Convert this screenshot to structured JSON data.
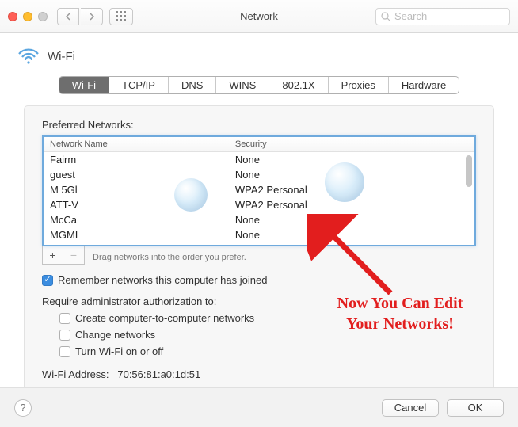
{
  "window": {
    "title": "Network",
    "search_placeholder": "Search"
  },
  "header": {
    "title": "Wi-Fi"
  },
  "tabs": [
    {
      "label": "Wi-Fi",
      "active": true
    },
    {
      "label": "TCP/IP",
      "active": false
    },
    {
      "label": "DNS",
      "active": false
    },
    {
      "label": "WINS",
      "active": false
    },
    {
      "label": "802.1X",
      "active": false
    },
    {
      "label": "Proxies",
      "active": false
    },
    {
      "label": "Hardware",
      "active": false
    }
  ],
  "networks": {
    "section_label": "Preferred Networks:",
    "columns": {
      "name": "Network Name",
      "security": "Security"
    },
    "rows": [
      {
        "name": "Fairm",
        "security": "None"
      },
      {
        "name": "guest",
        "security": "None"
      },
      {
        "name": "M 5Gl",
        "security": "WPA2 Personal"
      },
      {
        "name": "ATT-V",
        "security": "WPA2 Personal"
      },
      {
        "name": "McCa",
        "security": "None"
      },
      {
        "name": "MGMI",
        "security": "None"
      }
    ],
    "hint": "Drag networks into the order you prefer."
  },
  "options": {
    "remember_label": "Remember networks this computer has joined",
    "remember_checked": true,
    "admin_heading": "Require administrator authorization to:",
    "admin_items": [
      {
        "label": "Create computer-to-computer networks",
        "checked": false
      },
      {
        "label": "Change networks",
        "checked": false
      },
      {
        "label": "Turn Wi-Fi on or off",
        "checked": false
      }
    ]
  },
  "address": {
    "label": "Wi-Fi Address:",
    "value": "70:56:81:a0:1d:51"
  },
  "buttons": {
    "cancel": "Cancel",
    "ok": "OK"
  },
  "annotation": {
    "line1": "Now You Can Edit",
    "line2": "Your Networks!"
  }
}
